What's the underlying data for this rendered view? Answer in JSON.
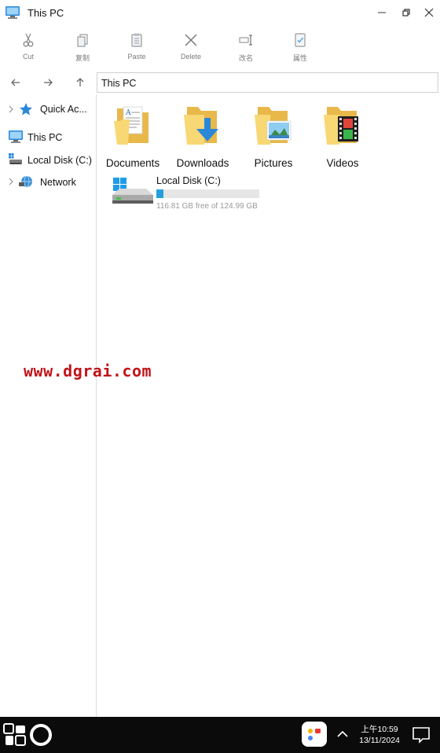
{
  "window": {
    "title": "This PC"
  },
  "ribbon": {
    "cut": "Cut",
    "copy": "复制",
    "paste": "Paste",
    "delete": "Delete",
    "rename": "改名",
    "properties": "属性"
  },
  "address": {
    "path": "This PC"
  },
  "sidebar": {
    "items": [
      {
        "label": "Quick Ac...",
        "icon": "star-icon"
      },
      {
        "label": "This PC",
        "icon": "computer-icon"
      },
      {
        "label": "Local Disk (C:)",
        "icon": "drive-icon"
      },
      {
        "label": "Network",
        "icon": "network-icon"
      }
    ]
  },
  "folders": [
    {
      "label": "Documents",
      "icon": "documents-folder-icon"
    },
    {
      "label": "Downloads",
      "icon": "downloads-folder-icon"
    },
    {
      "label": "Pictures",
      "icon": "pictures-folder-icon"
    },
    {
      "label": "Videos",
      "icon": "videos-folder-icon"
    }
  ],
  "drive": {
    "name": "Local Disk (C:)",
    "free_text": "116.81 GB free of 124.99 GB",
    "used_fraction": 0.065
  },
  "watermark": "www.dgrai.com",
  "taskbar": {
    "time": "上午10:59",
    "date": "13/11/2024"
  },
  "colors": {
    "accent": "#26a0da",
    "folder": "#f8d775",
    "taskbar": "#0b0b0b",
    "watermark": "#c0141a"
  }
}
